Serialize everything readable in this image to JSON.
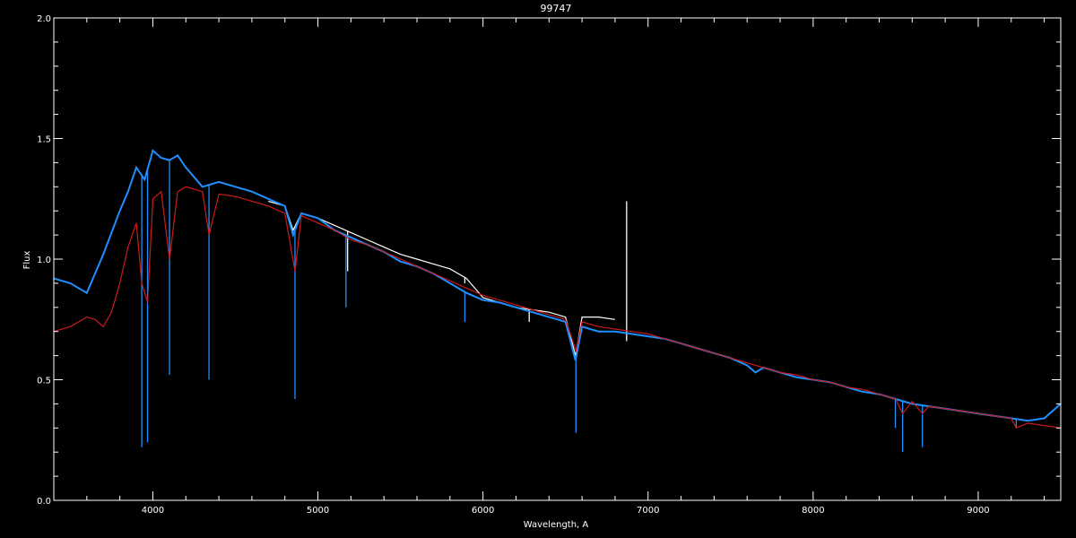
{
  "chart_data": {
    "type": "line",
    "title": "99747",
    "xlabel": "Wavelength, A",
    "ylabel": "Flux",
    "xlim": [
      3400,
      9500
    ],
    "ylim": [
      0.0,
      2.0
    ],
    "x_ticks": [
      4000,
      5000,
      6000,
      7000,
      8000,
      9000
    ],
    "x_tick_labels": [
      "4000",
      "5000",
      "6000",
      "7000",
      "8000",
      "9000"
    ],
    "y_ticks": [
      0.0,
      0.5,
      1.0,
      1.5,
      2.0
    ],
    "y_tick_labels": [
      "0.0",
      "0.5",
      "1.0",
      "1.5",
      "2.0"
    ],
    "background": "#000000",
    "axes_color": "#ffffff",
    "series": [
      {
        "color": "#ffffff",
        "x": [
          4700,
          4800,
          4850,
          4900,
          5000,
          5100,
          5200,
          5300,
          5400,
          5500,
          5600,
          5700,
          5800,
          5900,
          6000,
          6100,
          6200,
          6300,
          6400,
          6500,
          6560,
          6600,
          6700,
          6800
        ],
        "y": [
          1.24,
          1.22,
          1.12,
          1.19,
          1.17,
          1.14,
          1.11,
          1.08,
          1.05,
          1.02,
          1.0,
          0.98,
          0.96,
          0.92,
          0.84,
          0.82,
          0.8,
          0.79,
          0.78,
          0.76,
          0.6,
          0.76,
          0.76,
          0.75
        ],
        "absorption": [
          [
            5180,
            0.95
          ],
          [
            5890,
            0.9
          ],
          [
            6280,
            0.74
          ],
          [
            6870,
            0.66
          ]
        ]
      },
      {
        "color": "#1e90ff",
        "x": [
          3400,
          3500,
          3600,
          3700,
          3800,
          3850,
          3900,
          3950,
          4000,
          4050,
          4100,
          4150,
          4200,
          4300,
          4400,
          4500,
          4600,
          4700,
          4800,
          4850,
          4900,
          5000,
          5100,
          5200,
          5300,
          5400,
          5500,
          5600,
          5700,
          5800,
          5900,
          6000,
          6100,
          6200,
          6300,
          6400,
          6500,
          6560,
          6600,
          6700,
          6800,
          6900,
          7000,
          7100,
          7200,
          7300,
          7400,
          7500,
          7600,
          7650,
          7700,
          7800,
          7900,
          8000,
          8100,
          8200,
          8300,
          8400,
          8500,
          8600,
          8700,
          8800,
          8900,
          9000,
          9100,
          9200,
          9300,
          9400,
          9500
        ],
        "y": [
          0.92,
          0.9,
          0.86,
          1.02,
          1.2,
          1.28,
          1.38,
          1.33,
          1.45,
          1.42,
          1.41,
          1.43,
          1.38,
          1.3,
          1.32,
          1.3,
          1.28,
          1.25,
          1.22,
          1.1,
          1.19,
          1.17,
          1.12,
          1.09,
          1.06,
          1.03,
          0.99,
          0.97,
          0.94,
          0.9,
          0.86,
          0.83,
          0.82,
          0.8,
          0.78,
          0.76,
          0.74,
          0.58,
          0.72,
          0.7,
          0.7,
          0.69,
          0.68,
          0.67,
          0.65,
          0.63,
          0.61,
          0.59,
          0.56,
          0.53,
          0.55,
          0.53,
          0.51,
          0.5,
          0.49,
          0.47,
          0.45,
          0.44,
          0.42,
          0.4,
          0.39,
          0.38,
          0.37,
          0.36,
          0.35,
          0.34,
          0.33,
          0.34,
          0.4
        ],
        "absorption": [
          [
            3933,
            0.22
          ],
          [
            3968,
            0.24
          ],
          [
            4101,
            0.52
          ],
          [
            4340,
            0.5
          ],
          [
            4861,
            0.42
          ],
          [
            5170,
            0.8
          ],
          [
            5890,
            0.74
          ],
          [
            6563,
            0.28
          ],
          [
            8498,
            0.3
          ],
          [
            8542,
            0.2
          ],
          [
            8662,
            0.22
          ],
          [
            9230,
            0.3
          ]
        ]
      },
      {
        "color": "#cc1a1a",
        "x": [
          3400,
          3500,
          3600,
          3650,
          3700,
          3750,
          3800,
          3850,
          3900,
          3933,
          3968,
          4000,
          4050,
          4101,
          4150,
          4200,
          4250,
          4300,
          4340,
          4400,
          4500,
          4600,
          4700,
          4800,
          4861,
          4900,
          5000,
          5100,
          5200,
          5300,
          5400,
          5500,
          5600,
          5700,
          5800,
          5900,
          6000,
          6100,
          6200,
          6300,
          6400,
          6500,
          6563,
          6600,
          6700,
          6800,
          6900,
          7000,
          7100,
          7200,
          7300,
          7400,
          7500,
          7600,
          7700,
          7800,
          7900,
          8000,
          8100,
          8200,
          8300,
          8400,
          8500,
          8542,
          8600,
          8662,
          8700,
          8800,
          8900,
          9000,
          9100,
          9200,
          9230,
          9300,
          9400,
          9500
        ],
        "y": [
          0.7,
          0.72,
          0.76,
          0.75,
          0.72,
          0.78,
          0.9,
          1.05,
          1.15,
          0.9,
          0.82,
          1.25,
          1.28,
          1.0,
          1.28,
          1.3,
          1.29,
          1.28,
          1.1,
          1.27,
          1.26,
          1.24,
          1.22,
          1.19,
          0.95,
          1.18,
          1.15,
          1.12,
          1.08,
          1.06,
          1.03,
          1.0,
          0.97,
          0.94,
          0.91,
          0.88,
          0.85,
          0.83,
          0.81,
          0.79,
          0.77,
          0.75,
          0.62,
          0.74,
          0.72,
          0.71,
          0.7,
          0.69,
          0.67,
          0.65,
          0.63,
          0.61,
          0.59,
          0.57,
          0.55,
          0.53,
          0.52,
          0.5,
          0.49,
          0.47,
          0.46,
          0.44,
          0.42,
          0.36,
          0.41,
          0.36,
          0.39,
          0.38,
          0.37,
          0.36,
          0.35,
          0.34,
          0.3,
          0.32,
          0.31,
          0.3
        ]
      }
    ]
  }
}
